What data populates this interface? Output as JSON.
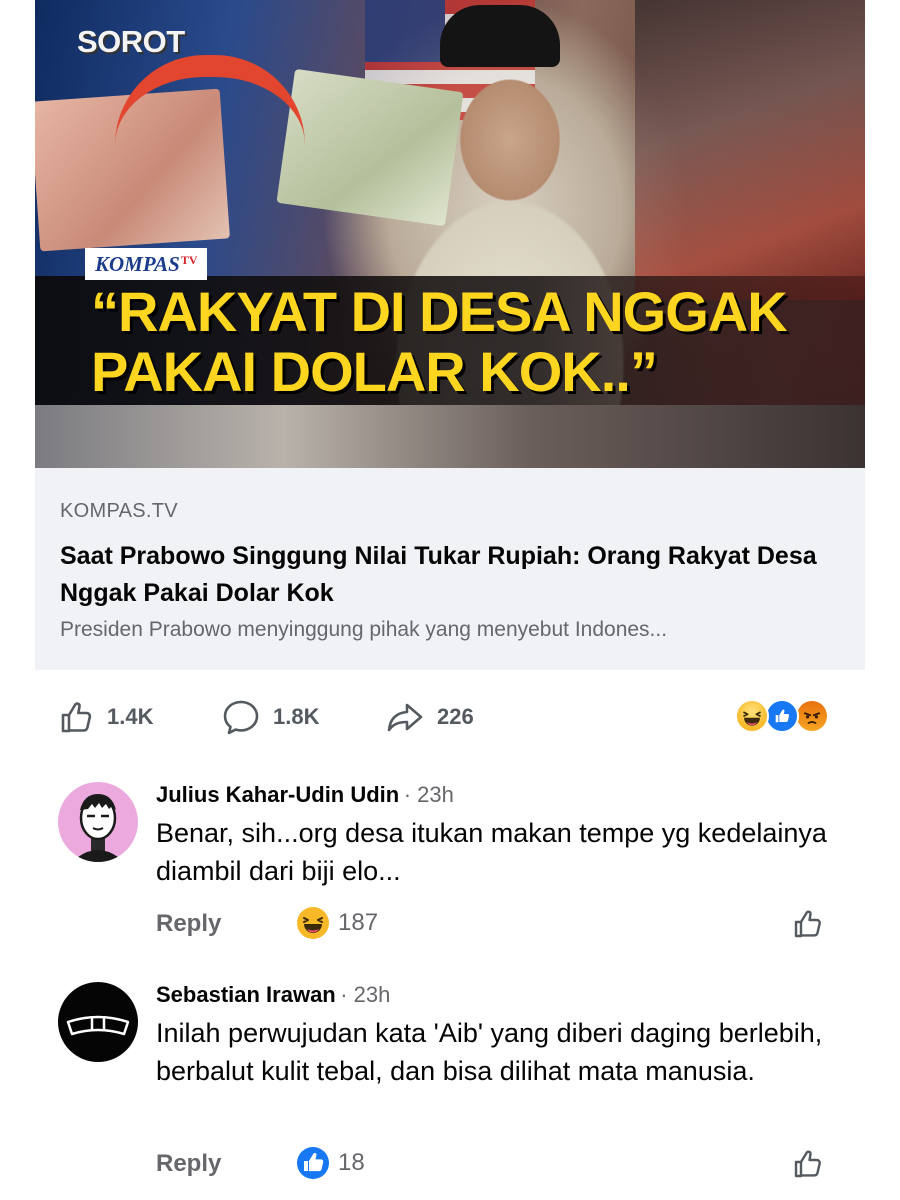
{
  "preview": {
    "thumbnail_tag": "SOROT",
    "thumbnail_brand": "KOMPAS",
    "thumbnail_brand_suffix": "TV",
    "thumbnail_headline": "“RAKYAT DI DESA NGGAK PAKAI DOLAR KOK..”",
    "domain": "KOMPAS.TV",
    "title": "Saat Prabowo Singgung Nilai Tukar Rupiah: Orang Rakyat Desa Nggak Pakai Dolar Kok",
    "description": "Presiden Prabowo menyinggung pihak yang menyebut Indones..."
  },
  "actions": {
    "likes": "1.4K",
    "comments": "1.8K",
    "shares": "226",
    "reactions": [
      "haha-icon",
      "like-icon",
      "angry-icon"
    ]
  },
  "comments": [
    {
      "author": "Julius Kahar-Udin Udin",
      "time": "· 23h",
      "text": "Benar, sih...org desa itukan makan tempe yg kedelainya diambil dari biji elo...",
      "reply_label": "Reply",
      "reaction": "haha-icon",
      "reaction_count": "187"
    },
    {
      "author": "Sebastian Irawan",
      "time": "· 23h",
      "text": "Inilah perwujudan kata 'Aib' yang diberi daging berlebih, berbalut kulit tebal, dan bisa dilihat mata manusia.",
      "reply_label": "Reply",
      "reaction": "like-icon",
      "reaction_count": "18"
    }
  ],
  "colors": {
    "accent": "#1877f2",
    "secondary_text": "#65676b",
    "card_bg": "#f0f2f5",
    "headline_yellow": "#ffd61f"
  }
}
